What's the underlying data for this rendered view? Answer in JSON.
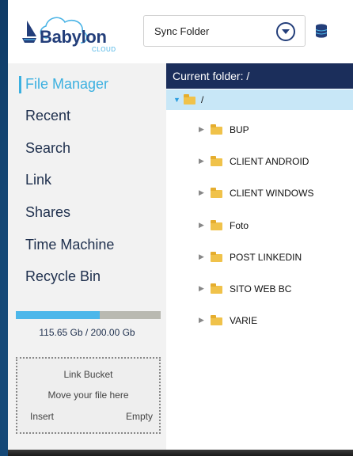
{
  "app": {
    "logo_text": "Babylon",
    "logo_sub": "CLOUD"
  },
  "header": {
    "sync_folder_label": "Sync Folder"
  },
  "sidebar": {
    "items": [
      {
        "label": "File Manager",
        "active": true
      },
      {
        "label": "Recent"
      },
      {
        "label": "Search"
      },
      {
        "label": "Link"
      },
      {
        "label": "Shares"
      },
      {
        "label": "Time Machine"
      },
      {
        "label": "Recycle Bin"
      }
    ],
    "storage": {
      "text": "115.65 Gb / 200.00 Gb",
      "used_fraction": 0.578
    },
    "bucket": {
      "title": "Link Bucket",
      "hint": "Move your file here",
      "insert_label": "Insert",
      "empty_label": "Empty"
    }
  },
  "main": {
    "current_folder_label": "Current folder: /",
    "root_label": "/",
    "folders": [
      "BUP",
      "CLIENT ANDROID",
      "CLIENT WINDOWS",
      "Foto",
      "POST LINKEDIN",
      "SITO WEB BC",
      "VARIE"
    ]
  },
  "colors": {
    "accent": "#3bb0e0",
    "brand_dark": "#233e7a",
    "path_bar": "#1b2e5b",
    "selected_row": "#c8e7f7",
    "folder": "#f0c24a"
  }
}
